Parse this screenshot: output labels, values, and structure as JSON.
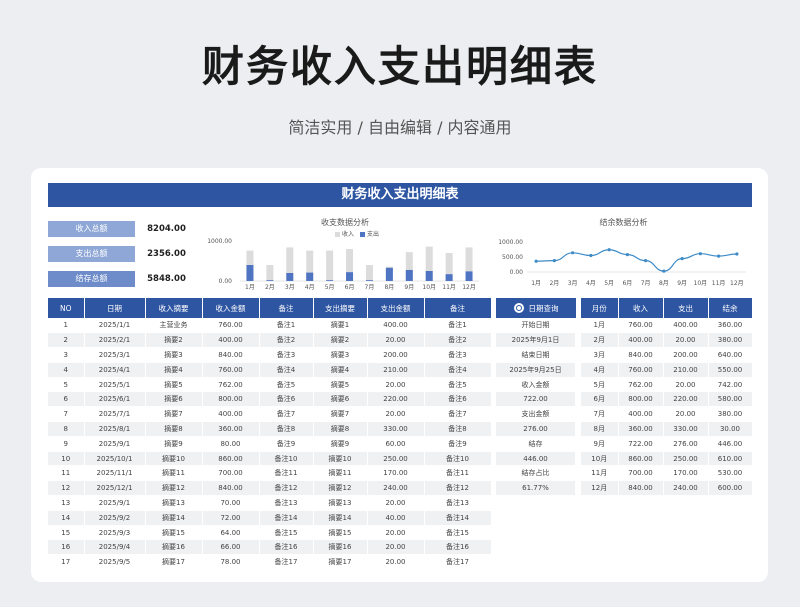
{
  "page": {
    "title": "财务收入支出明细表",
    "subtitle": "简洁实用 / 自由编辑 / 内容通用"
  },
  "sheet": {
    "banner": "财务收入支出明细表"
  },
  "summary": [
    {
      "label": "收入总额",
      "value": "8204.00"
    },
    {
      "label": "支出总额",
      "value": "2356.00"
    },
    {
      "label": "结存总额",
      "value": "5848.00"
    }
  ],
  "colors": {
    "primary": "#2e55a1",
    "income_bar": "#dcdcdc",
    "expense_bar": "#4e74c2",
    "line": "#3d8bc7"
  },
  "chart_data": [
    {
      "type": "bar",
      "title": "收支数据分析",
      "categories": [
        "1月",
        "2月",
        "3月",
        "4月",
        "5月",
        "6月",
        "7月",
        "8月",
        "9月",
        "10月",
        "11月",
        "12月"
      ],
      "series": [
        {
          "name": "收入",
          "values": [
            760,
            400,
            840,
            760,
            762,
            800,
            400,
            360,
            722,
            860,
            700,
            840
          ]
        },
        {
          "name": "支出",
          "values": [
            400,
            20,
            200,
            210,
            20,
            220,
            20,
            330,
            276,
            250,
            170,
            240
          ]
        }
      ],
      "y_ticks": [
        "1000.00",
        "0.00"
      ],
      "ylim": [
        0,
        1000
      ],
      "legend": "top"
    },
    {
      "type": "line",
      "title": "结余数据分析",
      "categories": [
        "1月",
        "2月",
        "3月",
        "4月",
        "5月",
        "6月",
        "7月",
        "8月",
        "9月",
        "10月",
        "11月",
        "12月"
      ],
      "series": [
        {
          "values": [
            360,
            380,
            640,
            550,
            742,
            580,
            380,
            30,
            446,
            610,
            530,
            600
          ]
        }
      ],
      "y_ticks": [
        "1000.00",
        "500.00",
        "0.00"
      ],
      "ylim": [
        0,
        1000
      ]
    }
  ],
  "detail": {
    "headers": [
      "NO",
      "日期",
      "收入摘要",
      "收入金额",
      "备注",
      "支出摘要",
      "支出金额",
      "备注"
    ],
    "rows": [
      [
        "1",
        "2025/1/1",
        "主营业务",
        "760.00",
        "备注1",
        "摘要1",
        "400.00",
        "备注1"
      ],
      [
        "2",
        "2025/2/1",
        "摘要2",
        "400.00",
        "备注2",
        "摘要2",
        "20.00",
        "备注2"
      ],
      [
        "3",
        "2025/3/1",
        "摘要3",
        "840.00",
        "备注3",
        "摘要3",
        "200.00",
        "备注3"
      ],
      [
        "4",
        "2025/4/1",
        "摘要4",
        "760.00",
        "备注4",
        "摘要4",
        "210.00",
        "备注4"
      ],
      [
        "5",
        "2025/5/1",
        "摘要5",
        "762.00",
        "备注5",
        "摘要5",
        "20.00",
        "备注5"
      ],
      [
        "6",
        "2025/6/1",
        "摘要6",
        "800.00",
        "备注6",
        "摘要6",
        "220.00",
        "备注6"
      ],
      [
        "7",
        "2025/7/1",
        "摘要7",
        "400.00",
        "备注7",
        "摘要7",
        "20.00",
        "备注7"
      ],
      [
        "8",
        "2025/8/1",
        "摘要8",
        "360.00",
        "备注8",
        "摘要8",
        "330.00",
        "备注8"
      ],
      [
        "9",
        "2025/9/1",
        "摘要9",
        "80.00",
        "备注9",
        "摘要9",
        "60.00",
        "备注9"
      ],
      [
        "10",
        "2025/10/1",
        "摘要10",
        "860.00",
        "备注10",
        "摘要10",
        "250.00",
        "备注10"
      ],
      [
        "11",
        "2025/11/1",
        "摘要11",
        "700.00",
        "备注11",
        "摘要11",
        "170.00",
        "备注11"
      ],
      [
        "12",
        "2025/12/1",
        "摘要12",
        "840.00",
        "备注12",
        "摘要12",
        "240.00",
        "备注12"
      ],
      [
        "13",
        "2025/9/1",
        "摘要13",
        "70.00",
        "备注13",
        "摘要13",
        "20.00",
        "备注13"
      ],
      [
        "14",
        "2025/9/2",
        "摘要14",
        "72.00",
        "备注14",
        "摘要14",
        "40.00",
        "备注14"
      ],
      [
        "15",
        "2025/9/3",
        "摘要15",
        "64.00",
        "备注15",
        "摘要15",
        "20.00",
        "备注15"
      ],
      [
        "16",
        "2025/9/4",
        "摘要16",
        "66.00",
        "备注16",
        "摘要16",
        "20.00",
        "备注16"
      ],
      [
        "17",
        "2025/9/5",
        "摘要17",
        "78.00",
        "备注17",
        "摘要17",
        "20.00",
        "备注17"
      ]
    ]
  },
  "query": {
    "header": "日期查询",
    "icon": "search-icon",
    "items": [
      "开始日期",
      "2025年9月1日",
      "结束日期",
      "2025年9月25日",
      "收入金额",
      "722.00",
      "支出金额",
      "276.00",
      "结存",
      "446.00",
      "结存占比",
      "61.77%"
    ]
  },
  "monthly": {
    "headers": [
      "月份",
      "收入",
      "支出",
      "结余"
    ],
    "rows": [
      [
        "1月",
        "760.00",
        "400.00",
        "360.00"
      ],
      [
        "2月",
        "400.00",
        "20.00",
        "380.00"
      ],
      [
        "3月",
        "840.00",
        "200.00",
        "640.00"
      ],
      [
        "4月",
        "760.00",
        "210.00",
        "550.00"
      ],
      [
        "5月",
        "762.00",
        "20.00",
        "742.00"
      ],
      [
        "6月",
        "800.00",
        "220.00",
        "580.00"
      ],
      [
        "7月",
        "400.00",
        "20.00",
        "380.00"
      ],
      [
        "8月",
        "360.00",
        "330.00",
        "30.00"
      ],
      [
        "9月",
        "722.00",
        "276.00",
        "446.00"
      ],
      [
        "10月",
        "860.00",
        "250.00",
        "610.00"
      ],
      [
        "11月",
        "700.00",
        "170.00",
        "530.00"
      ],
      [
        "12月",
        "840.00",
        "240.00",
        "600.00"
      ]
    ]
  }
}
